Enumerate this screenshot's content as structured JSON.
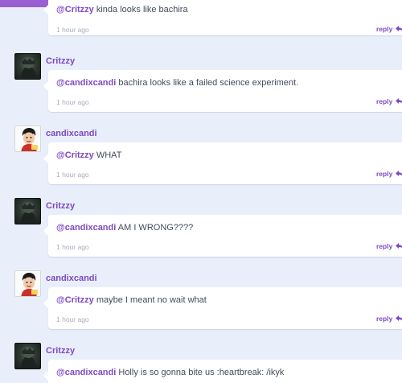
{
  "colors": {
    "accent": "#7d49c4",
    "topbar": "#9a5fd1",
    "background": "#e9effa"
  },
  "comments": [
    {
      "user": "",
      "avatar": "",
      "mention": "@Critzzy",
      "text": " kinda looks like bachira",
      "time": "1 hour ago",
      "reply": "reply"
    },
    {
      "user": "Critzzy",
      "avatar": "dark-anime-avatar",
      "mention": "@candixcandi",
      "text": " bachira looks like a failed science experiment.",
      "time": "1 hour ago",
      "reply": "reply"
    },
    {
      "user": "candixcandi",
      "avatar": "cartoon-avatar",
      "mention": "@Critzzy",
      "text": " WHAT",
      "time": "1 hour ago",
      "reply": "reply"
    },
    {
      "user": "Critzzy",
      "avatar": "dark-anime-avatar",
      "mention": "@candixcandi",
      "text": " AM I WRONG????",
      "time": "1 hour ago",
      "reply": "reply"
    },
    {
      "user": "candixcandi",
      "avatar": "cartoon-avatar",
      "mention": "@Critzzy",
      "text": " maybe I meant no wait what",
      "time": "1 hour ago",
      "reply": "reply"
    },
    {
      "user": "Critzzy",
      "avatar": "dark-anime-avatar",
      "mention": "@candixcandi",
      "text": " Holly is so gonna bite us :heartbreak: /ikyk",
      "time": "",
      "reply": ""
    }
  ]
}
